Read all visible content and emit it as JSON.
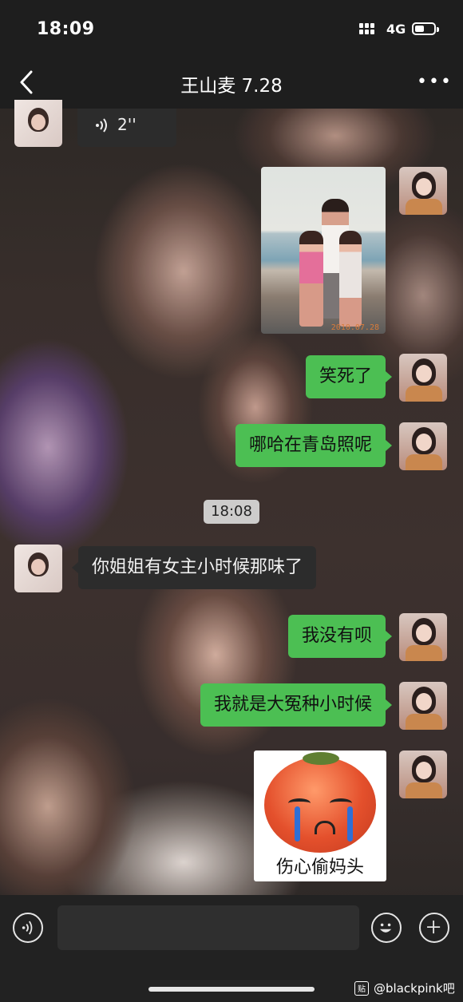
{
  "status_bar": {
    "time": "18:09",
    "network": "4G",
    "battery_fraction": 0.5
  },
  "header": {
    "back_icon": "chevron-left-icon",
    "title": "王山麦 7.28",
    "more_icon": "more-dots-icon",
    "more_label": "•••"
  },
  "messages": [
    {
      "type": "voice",
      "side": "left",
      "duration": "2''"
    },
    {
      "type": "image",
      "side": "right",
      "photo_date": "2010.07.28"
    },
    {
      "type": "text",
      "side": "right",
      "text": "笑死了"
    },
    {
      "type": "text",
      "side": "right",
      "text": "哪哈在青岛照呢"
    },
    {
      "type": "time",
      "text": "18:08"
    },
    {
      "type": "text",
      "side": "left",
      "text": "你姐姐有女主小时候那味了"
    },
    {
      "type": "text",
      "side": "right",
      "text": "我没有呗"
    },
    {
      "type": "text",
      "side": "right",
      "text": "我就是大冤种小时候"
    },
    {
      "type": "sticker",
      "side": "right",
      "caption": "伤心偷妈头"
    }
  ],
  "input_bar": {
    "voice_icon": "voice-input-icon",
    "text_value": "",
    "emoji_icon": "emoji-icon",
    "plus_icon": "plus-icon"
  },
  "watermark": {
    "logo_text": "贴",
    "text": "@blackpink吧"
  },
  "colors": {
    "bubble_self": "#4cbf53",
    "bubble_other": "#2c2c2c",
    "bar": "#1e1e1e"
  }
}
